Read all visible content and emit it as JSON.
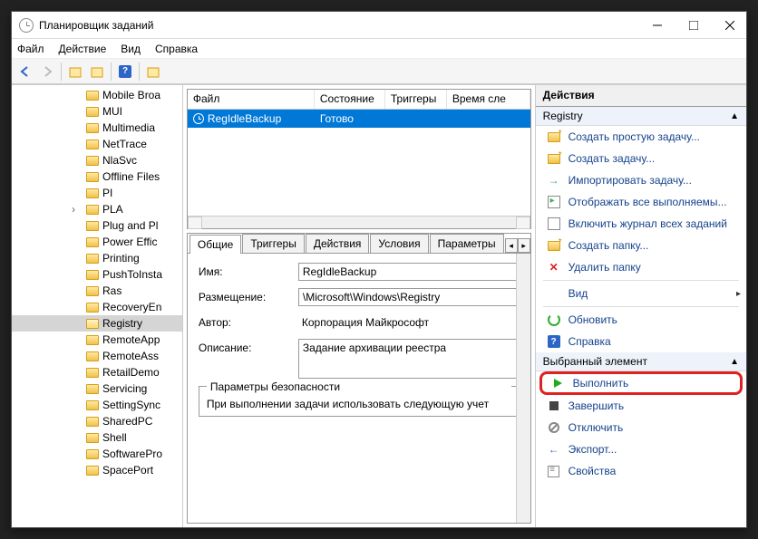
{
  "title": "Планировщик заданий",
  "menu": {
    "file": "Файл",
    "action": "Действие",
    "view": "Вид",
    "help": "Справка"
  },
  "tree": [
    {
      "label": "Mobile Broa"
    },
    {
      "label": "MUI"
    },
    {
      "label": "Multimedia"
    },
    {
      "label": "NetTrace"
    },
    {
      "label": "NlaSvc"
    },
    {
      "label": "Offline Files"
    },
    {
      "label": "PI"
    },
    {
      "label": "PLA",
      "expander": true
    },
    {
      "label": "Plug and Pl"
    },
    {
      "label": "Power Effic"
    },
    {
      "label": "Printing"
    },
    {
      "label": "PushToInsta"
    },
    {
      "label": "Ras"
    },
    {
      "label": "RecoveryEn"
    },
    {
      "label": "Registry",
      "selected": true,
      "open": true
    },
    {
      "label": "RemoteApp"
    },
    {
      "label": "RemoteAss"
    },
    {
      "label": "RetailDemo"
    },
    {
      "label": "Servicing"
    },
    {
      "label": "SettingSync"
    },
    {
      "label": "SharedPC"
    },
    {
      "label": "Shell"
    },
    {
      "label": "SoftwarePro"
    },
    {
      "label": "SpacePort"
    }
  ],
  "task_columns": {
    "file": "Файл",
    "state": "Состояние",
    "triggers": "Триггеры",
    "next_time": "Время сле"
  },
  "task_row": {
    "name": "RegIdleBackup",
    "state": "Готово"
  },
  "tabs": [
    "Общие",
    "Триггеры",
    "Действия",
    "Условия",
    "Параметры"
  ],
  "form": {
    "name_label": "Имя:",
    "name_value": "RegIdleBackup",
    "location_label": "Размещение:",
    "location_value": "\\Microsoft\\Windows\\Registry",
    "author_label": "Автор:",
    "author_value": "Корпорация Майкрософт",
    "desc_label": "Описание:",
    "desc_value": "Задание архивации реестра",
    "security_legend": "Параметры безопасности",
    "security_text": "При выполнении задачи использовать следующую учет"
  },
  "actions": {
    "header": "Действия",
    "group1": "Registry",
    "items1": [
      {
        "icon": "folder-new",
        "label": "Создать простую задачу..."
      },
      {
        "icon": "folder-new",
        "label": "Создать задачу..."
      },
      {
        "icon": "import",
        "label": "Импортировать задачу..."
      },
      {
        "icon": "running",
        "label": "Отображать все выполняемы..."
      },
      {
        "icon": "log",
        "label": "Включить журнал всех заданий"
      },
      {
        "icon": "folder-new",
        "label": "Создать папку..."
      },
      {
        "icon": "delete",
        "label": "Удалить папку"
      }
    ],
    "view": "Вид",
    "refresh": "Обновить",
    "help": "Справка",
    "group2": "Выбранный элемент",
    "run": "Выполнить",
    "end": "Завершить",
    "disable": "Отключить",
    "export": "Экспорт...",
    "props": "Свойства"
  }
}
